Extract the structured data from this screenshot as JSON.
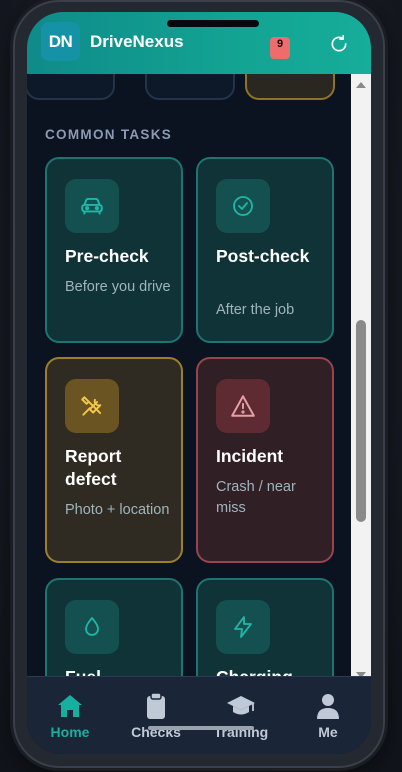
{
  "app": {
    "logo_text": "DN",
    "title": "DriveNexus",
    "notification_count": "9"
  },
  "icons": {
    "refresh": "refresh-icon"
  },
  "section": {
    "title": "COMMON TASKS"
  },
  "cards": [
    {
      "title": "Pre-check",
      "subtitle": "Before you drive",
      "icon": "car-icon",
      "tone": "teal"
    },
    {
      "title": "Post-check",
      "subtitle": "After the job",
      "icon": "check-circle-icon",
      "tone": "teal"
    },
    {
      "title": "Report defect",
      "subtitle": "Photo + location",
      "icon": "tools-icon",
      "tone": "amber"
    },
    {
      "title": "Incident",
      "subtitle": "Crash / near miss",
      "icon": "warning-icon",
      "tone": "red"
    },
    {
      "title": "Fuel",
      "subtitle": "",
      "icon": "drop-icon",
      "tone": "teal"
    },
    {
      "title": "Charging",
      "subtitle": "",
      "icon": "bolt-icon",
      "tone": "teal"
    }
  ],
  "nav": [
    {
      "label": "Home",
      "icon": "home-icon",
      "active": true
    },
    {
      "label": "Checks",
      "icon": "clipboard-icon",
      "active": false
    },
    {
      "label": "Training",
      "icon": "graduation-cap-icon",
      "active": false
    },
    {
      "label": "Me",
      "icon": "user-icon",
      "active": false
    }
  ],
  "colors": {
    "accent": "#17b0a0",
    "header_start": "#0f8b89",
    "header_end": "#16ad9a",
    "background": "#0b1220",
    "badge": "#f06b6b",
    "defect": "#9b7f2a",
    "incident": "#98444e"
  }
}
